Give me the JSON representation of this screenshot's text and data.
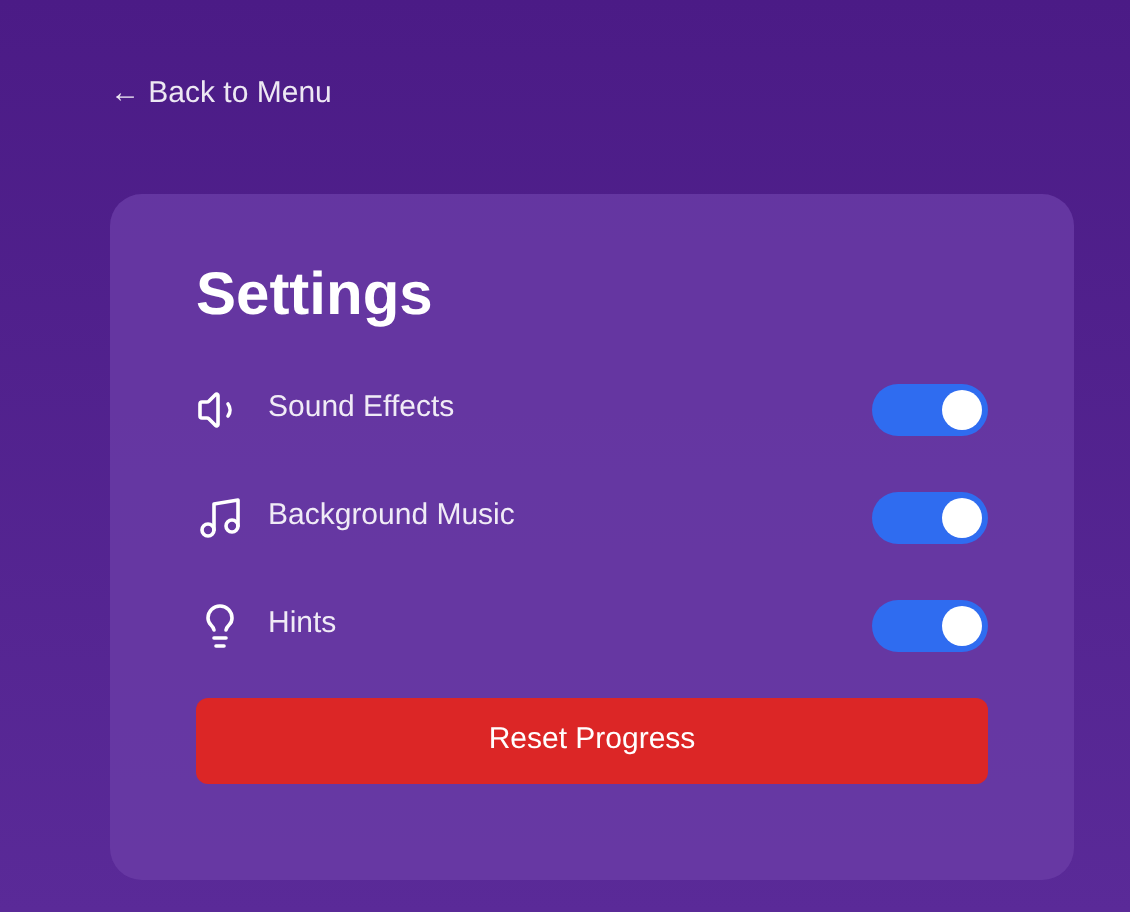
{
  "back_link": {
    "label": "← Back to Menu"
  },
  "settings": {
    "title": "Settings",
    "items": [
      {
        "kind": "sound",
        "label": "Sound Effects",
        "on": true
      },
      {
        "kind": "music",
        "label": "Background Music",
        "on": true
      },
      {
        "kind": "hints",
        "label": "Hints",
        "on": true
      }
    ],
    "reset_button": "Reset Progress"
  }
}
